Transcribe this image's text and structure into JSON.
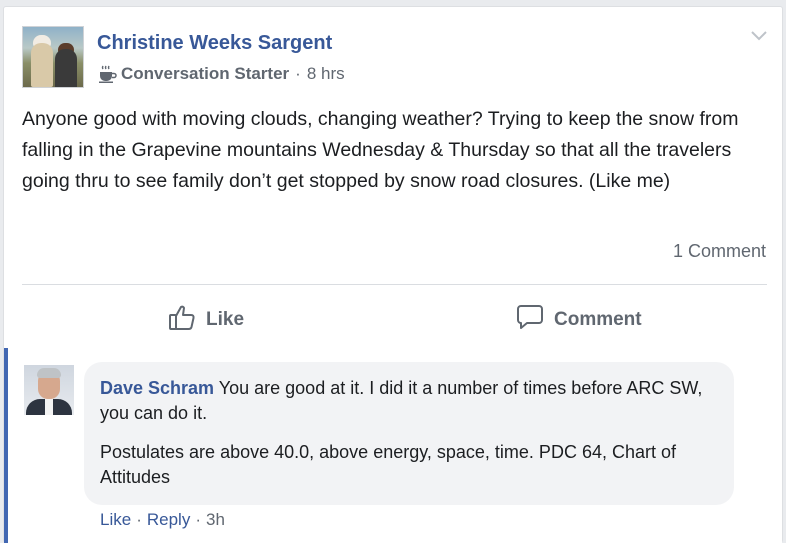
{
  "post": {
    "author": "Christine Weeks Sargent",
    "badge": "Conversation Starter",
    "badge_icon": "coffee-cup-icon",
    "separator": "·",
    "time": "8 hrs",
    "text": "Anyone good with moving clouds, changing weather? Trying to keep the snow from falling in the Grapevine mountains Wednesday & Thursday so that all the travelers going thru to see family don’t get stopped by snow road closures. (Like me)",
    "comment_count": "1 Comment"
  },
  "actions": {
    "like_label": "Like",
    "comment_label": "Comment"
  },
  "comment": {
    "author": "Dave Schram",
    "text_1": "You are good at it. I did it a number of times before ARC SW, you can do it.",
    "text_2": "Postulates are above 40.0, above energy, space, time. PDC 64, Chart of Attitudes",
    "like_link": "Like",
    "reply_link": "Reply",
    "separator": "·",
    "time": "3h"
  },
  "colors": {
    "link_blue": "#385898",
    "accent_bar": "#4267b2",
    "meta_gray": "#606770",
    "bubble_bg": "#f2f3f5"
  }
}
